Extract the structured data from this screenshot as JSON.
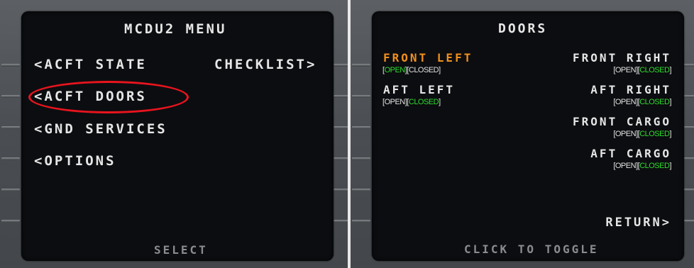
{
  "left": {
    "title": "MCDU2 MENU",
    "lsk": {
      "l1": "<ACFT STATE",
      "r1": "CHECKLIST>",
      "l2": "<ACFT DOORS",
      "l3": "<GND SERVICES",
      "l4": "<OPTIONS"
    },
    "footer": "SELECT",
    "annotation": "red ellipse highlight around ACFT DOORS"
  },
  "right": {
    "title": "DOORS",
    "doors": [
      {
        "label": "FRONT LEFT",
        "open": "OPEN",
        "closed": "CLOSED",
        "state": "OPEN"
      },
      {
        "label": "FRONT RIGHT",
        "open": "OPEN",
        "closed": "CLOSED",
        "state": "CLOSED"
      },
      {
        "label": "AFT LEFT",
        "open": "OPEN",
        "closed": "CLOSED",
        "state": "CLOSED"
      },
      {
        "label": "AFT RIGHT",
        "open": "OPEN",
        "closed": "CLOSED",
        "state": "CLOSED"
      },
      {
        "label": "FRONT CARGO",
        "open": "OPEN",
        "closed": "CLOSED",
        "state": "CLOSED"
      },
      {
        "label": "AFT CARGO",
        "open": "OPEN",
        "closed": "CLOSED",
        "state": "CLOSED"
      }
    ],
    "return": "RETURN>",
    "footer": "CLICK TO TOGGLE"
  },
  "colors": {
    "text": "#e6e6e6",
    "amber": "#f0901c",
    "green": "#2edc2e",
    "grey": "#8a8c8f",
    "annotation": "#e8141e"
  }
}
